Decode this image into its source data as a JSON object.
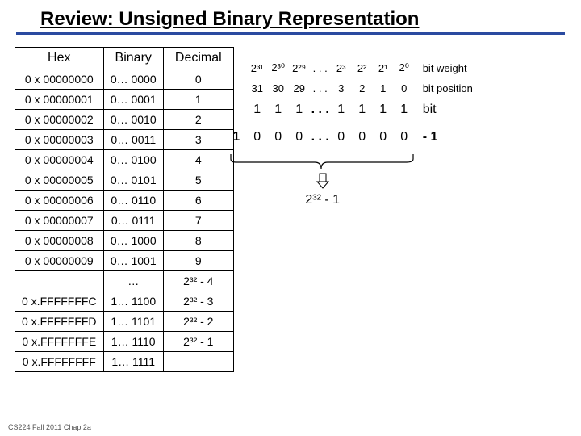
{
  "title": "Review:  Unsigned Binary Representation",
  "table": {
    "headers": [
      "Hex",
      "Binary",
      "Decimal"
    ],
    "rows": [
      {
        "hex": "0 x 00000000",
        "bin": "0… 0000",
        "dec": "0"
      },
      {
        "hex": "0 x 00000001",
        "bin": "0… 0001",
        "dec": "1"
      },
      {
        "hex": "0 x 00000002",
        "bin": "0… 0010",
        "dec": "2"
      },
      {
        "hex": "0 x 00000003",
        "bin": "0… 0011",
        "dec": "3"
      },
      {
        "hex": "0 x 00000004",
        "bin": "0… 0100",
        "dec": "4"
      },
      {
        "hex": "0 x 00000005",
        "bin": "0… 0101",
        "dec": "5"
      },
      {
        "hex": "0 x 00000006",
        "bin": "0… 0110",
        "dec": "6"
      },
      {
        "hex": "0 x 00000007",
        "bin": "0… 0111",
        "dec": "7"
      },
      {
        "hex": "0 x 00000008",
        "bin": "0… 1000",
        "dec": "8"
      },
      {
        "hex": "0 x 00000009",
        "bin": "0… 1001",
        "dec": "9"
      },
      {
        "hex": "",
        "bin": "…",
        "dec": "2³² - 4"
      },
      {
        "hex": "0 x.FFFFFFFC",
        "bin": "1… 1100",
        "dec": "2³² - 3"
      },
      {
        "hex": "0 x.FFFFFFFD",
        "bin": "1… 1101",
        "dec": "2³² - 2"
      },
      {
        "hex": "0 x.FFFFFFFE",
        "bin": "1… 1110",
        "dec": "2³² - 1"
      },
      {
        "hex": "0 x.FFFFFFFF",
        "bin": "1… 1111",
        "dec": ""
      }
    ]
  },
  "weights": {
    "high": [
      "2³¹",
      "2³⁰",
      "2²⁹"
    ],
    "low": [
      "2³",
      "2²",
      "2¹",
      "2⁰"
    ],
    "label": "bit weight"
  },
  "positions": {
    "high": [
      "31",
      "30",
      "29"
    ],
    "low": [
      "3",
      "2",
      "1",
      "0"
    ],
    "label": "bit position"
  },
  "bits": {
    "high": [
      "1",
      "1",
      "1"
    ],
    "low": [
      "1",
      "1",
      "1",
      "1"
    ],
    "label": "bit"
  },
  "calc": {
    "lead": "1",
    "high": [
      "0",
      "0",
      "0"
    ],
    "low": [
      "0",
      "0",
      "0",
      "0"
    ],
    "result_label": "-  1"
  },
  "dots": ". . .",
  "power_result": "2³²  -  1",
  "footer": "CS224 Fall 2011  Chap 2a"
}
